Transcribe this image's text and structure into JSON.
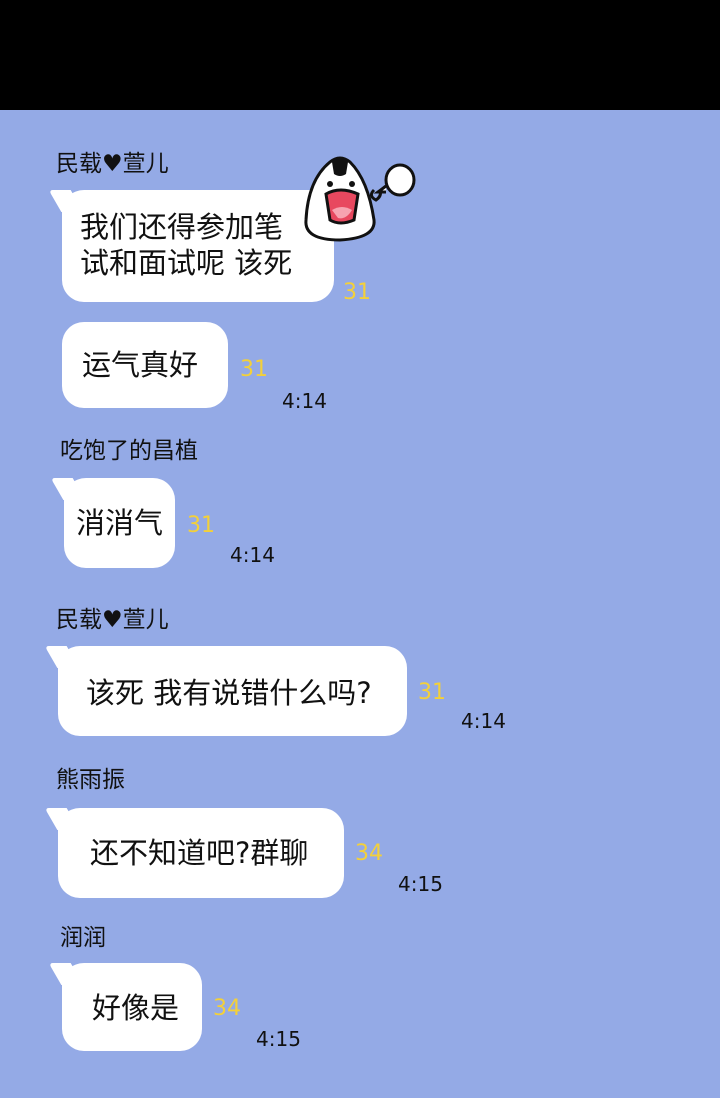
{
  "messages": [
    {
      "sender": "民载♥萱儿",
      "lines": [
        "我们还得参加笔",
        "试和面试呢 该死"
      ],
      "read_count": "31"
    },
    {
      "sender": "",
      "lines": [
        "运气真好"
      ],
      "read_count": "31",
      "time": "4:14"
    },
    {
      "sender": "吃饱了的昌植",
      "lines": [
        "消消气"
      ],
      "read_count": "31",
      "time": "4:14"
    },
    {
      "sender": "民载♥萱儿",
      "lines": [
        "该死 我有说错什么吗?"
      ],
      "read_count": "31",
      "time": "4:14"
    },
    {
      "sender": "熊雨振",
      "lines": [
        "还不知道吧?群聊"
      ],
      "read_count": "34",
      "time": "4:15"
    },
    {
      "sender": "润润",
      "lines": [
        "好像是"
      ],
      "read_count": "34",
      "time": "4:15"
    }
  ],
  "colors": {
    "background": "#94aae6",
    "read_count": "#f3d03a",
    "bubble": "#ffffff",
    "top_bar": "#000000"
  },
  "sticker": {
    "icon": "angry-onigiri-sticker"
  }
}
